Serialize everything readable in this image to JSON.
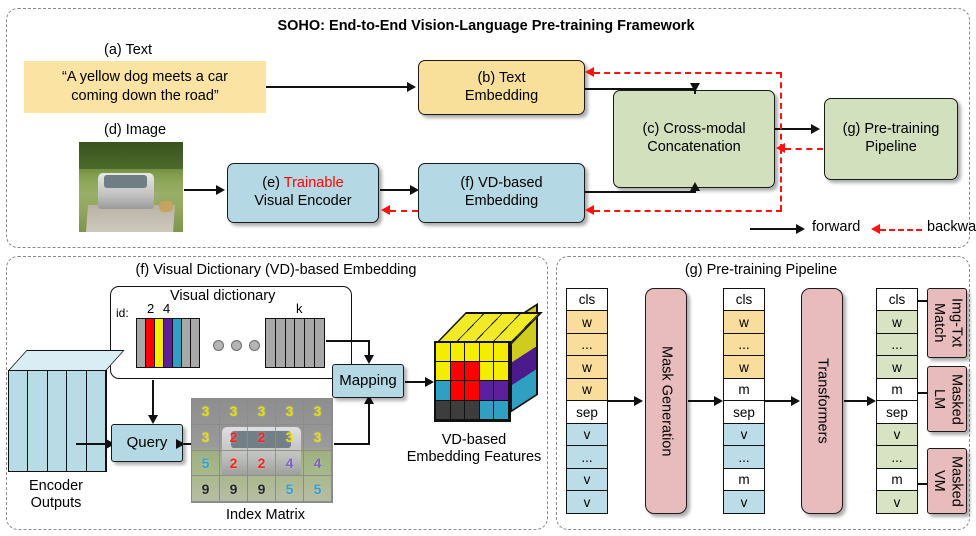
{
  "figure": {
    "panels": {
      "top": {
        "title": "SOHO: End-to-End Vision-Language Pre-training Framework",
        "text_caption": "(a) Text",
        "text_sentence": "“A yellow dog meets a car coming down the road”",
        "text_sentence_line1": "“A yellow dog meets a car",
        "text_sentence_line2": "coming down the road”",
        "image_caption": "(d) Image",
        "boxes": {
          "text_embedding_l1": "(b) Text",
          "text_embedding_l2": "Embedding",
          "visual_encoder_prefix": "(e) ",
          "visual_encoder_highlight": "Trainable",
          "visual_encoder_l2": "Visual Encoder",
          "vd_embedding_l1": "(f) VD-based",
          "vd_embedding_l2": "Embedding",
          "cross_modal_l1": "(c) Cross-modal",
          "cross_modal_l2": "Concatenation",
          "pretraining_l1": "(g) Pre-training",
          "pretraining_l2": "Pipeline"
        },
        "legend": {
          "forward": "forward",
          "backward": "backward"
        }
      },
      "bottom_left": {
        "title": "(f) Visual Dictionary (VD)-based Embedding",
        "dictionary_title": "Visual dictionary",
        "id_label": "id:",
        "id_2": "2",
        "id_4": "4",
        "id_k": "k",
        "query_label": "Query",
        "mapping_label": "Mapping",
        "encoder_outputs_l1": "Encoder",
        "encoder_outputs_l2": "Outputs",
        "index_matrix_label": "Index Matrix",
        "vd_features_l1": "VD-based",
        "vd_features_l2": "Embedding Features",
        "index_matrix": [
          [
            {
              "value": "3",
              "color": "#e8e000"
            },
            {
              "value": "3",
              "color": "#e8e000"
            },
            {
              "value": "3",
              "color": "#e8e000"
            },
            {
              "value": "3",
              "color": "#e8e000"
            },
            {
              "value": "3",
              "color": "#e8e000"
            }
          ],
          [
            {
              "value": "3",
              "color": "#e8e000"
            },
            {
              "value": "2",
              "color": "#ff2020"
            },
            {
              "value": "2",
              "color": "#ff2020"
            },
            {
              "value": "3",
              "color": "#e8e000"
            },
            {
              "value": "3",
              "color": "#e8e000"
            }
          ],
          [
            {
              "value": "5",
              "color": "#2f9fd8"
            },
            {
              "value": "2",
              "color": "#ff2020"
            },
            {
              "value": "2",
              "color": "#ff2020"
            },
            {
              "value": "4",
              "color": "#7b62c8"
            },
            {
              "value": "4",
              "color": "#7b62c8"
            }
          ],
          [
            {
              "value": "9",
              "color": "#262626"
            },
            {
              "value": "9",
              "color": "#262626"
            },
            {
              "value": "9",
              "color": "#262626"
            },
            {
              "value": "5",
              "color": "#2f9fd8"
            },
            {
              "value": "5",
              "color": "#2f9fd8"
            }
          ]
        ],
        "dictionary_bars": [
          "#a8a8a8",
          "#ff0000",
          "#f5ed00",
          "#5c1f9e",
          "#2f9fc2",
          "#a8a8a8",
          "#a8a8a8"
        ],
        "dictionary_bars_k": [
          "#a8a8a8",
          "#a8a8a8",
          "#a8a8a8",
          "#a8a8a8",
          "#a8a8a8",
          "#a8a8a8"
        ],
        "cube_front": [
          [
            "#f5ed00",
            "#f5ed00",
            "#f5ed00",
            "#f5ed00",
            "#f5ed00"
          ],
          [
            "#f5ed00",
            "#ff0000",
            "#ff0000",
            "#f5ed00",
            "#f5ed00"
          ],
          [
            "#2f9fc2",
            "#ff0000",
            "#ff0000",
            "#5c1f9e",
            "#5c1f9e"
          ],
          [
            "#3d3d3d",
            "#3d3d3d",
            "#3d3d3d",
            "#2f9fc2",
            "#2f9fc2"
          ]
        ]
      },
      "bottom_right": {
        "title": "(g) Pre-training Pipeline",
        "mask_generation_label": "Mask Generation",
        "transformers_label": "Transformers",
        "columns": [
          {
            "name": "input-tokens",
            "tokens": [
              {
                "label": "cls",
                "style": "w"
              },
              {
                "label": "w",
                "style": "y"
              },
              {
                "label": "...",
                "style": "y"
              },
              {
                "label": "w",
                "style": "y"
              },
              {
                "label": "w",
                "style": "y"
              },
              {
                "label": "sep",
                "style": "w"
              },
              {
                "label": "v",
                "style": "b"
              },
              {
                "label": "...",
                "style": "b"
              },
              {
                "label": "v",
                "style": "b"
              },
              {
                "label": "v",
                "style": "b"
              }
            ]
          },
          {
            "name": "masked-tokens",
            "tokens": [
              {
                "label": "cls",
                "style": "w"
              },
              {
                "label": "w",
                "style": "y"
              },
              {
                "label": "...",
                "style": "y"
              },
              {
                "label": "w",
                "style": "y"
              },
              {
                "label": "m",
                "style": "w"
              },
              {
                "label": "sep",
                "style": "w"
              },
              {
                "label": "v",
                "style": "b"
              },
              {
                "label": "...",
                "style": "b"
              },
              {
                "label": "m",
                "style": "w"
              },
              {
                "label": "v",
                "style": "b"
              }
            ]
          },
          {
            "name": "output-tokens",
            "tokens": [
              {
                "label": "cls",
                "style": "w"
              },
              {
                "label": "w",
                "style": "g"
              },
              {
                "label": "...",
                "style": "g"
              },
              {
                "label": "w",
                "style": "g"
              },
              {
                "label": "m",
                "style": "w"
              },
              {
                "label": "sep",
                "style": "w"
              },
              {
                "label": "v",
                "style": "g"
              },
              {
                "label": "...",
                "style": "g"
              },
              {
                "label": "m",
                "style": "w"
              },
              {
                "label": "v",
                "style": "g"
              }
            ]
          }
        ],
        "heads": [
          {
            "name": "img-txt-match",
            "l1": "Img-Txt",
            "l2": "Match"
          },
          {
            "name": "masked-lm",
            "l1": "Masked",
            "l2": "LM"
          },
          {
            "name": "masked-vm",
            "l1": "Masked",
            "l2": "VM"
          }
        ]
      }
    },
    "colors": {
      "yellow_box": "#f8e09a",
      "blue_box": "#b4d9e4",
      "green_box": "#d3e0bd",
      "pink_box": "#e8bcbc",
      "accent_red": "#ff0000",
      "panel_border": "#8a8a8a"
    }
  }
}
